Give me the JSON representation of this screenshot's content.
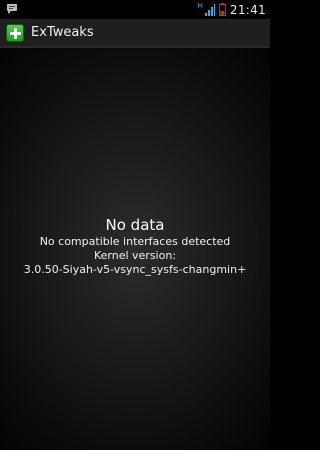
{
  "status_bar": {
    "notification_icon": "chat-bubble-icon",
    "network_type": "H",
    "time": "21:41",
    "signal_icon": "signal-bars-icon",
    "battery_icon": "battery-icon"
  },
  "action_bar": {
    "app_icon": "green-plus-icon",
    "title": "ExTweaks",
    "accent_color": "#2eb82e"
  },
  "content": {
    "heading": "No data",
    "message": "No compatible interfaces detected",
    "kernel_label": "Kernel version:",
    "kernel_value": "3.0.50-Siyah-v5-vsync_sysfs-changmin+"
  }
}
